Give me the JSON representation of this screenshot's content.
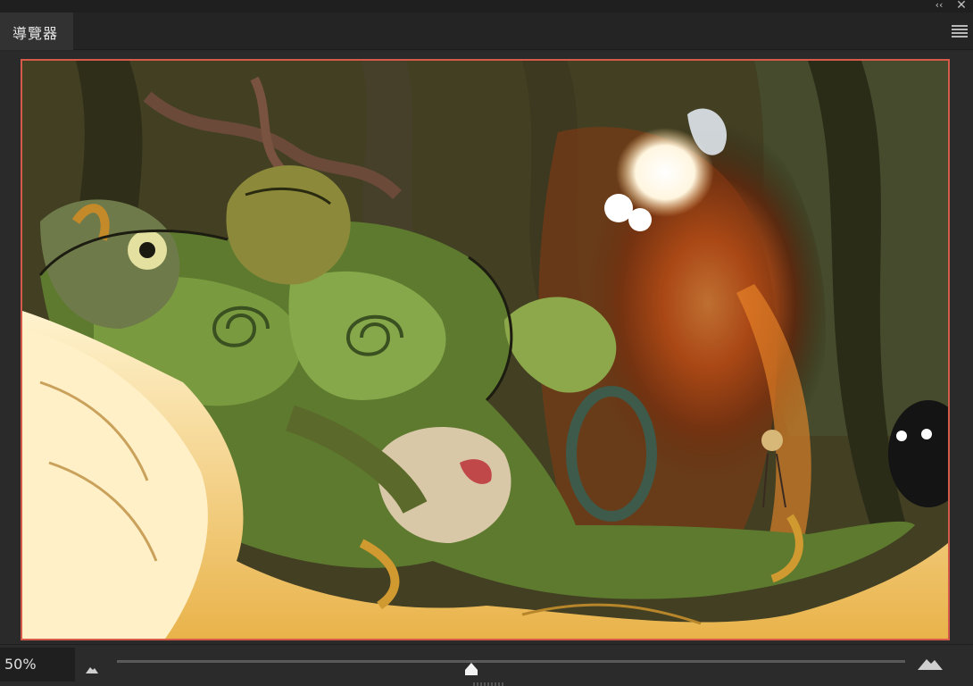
{
  "panel": {
    "tab_label": "導覽器",
    "collapse_glyph": "‹‹",
    "close_glyph": "✕"
  },
  "icons": {
    "collapse": "double-chevron-left-icon",
    "close": "close-icon",
    "menu": "hamburger-menu-icon",
    "zoom_out": "small-mountain-icon",
    "zoom_in": "large-mountain-icon"
  },
  "zoom": {
    "value": "50%",
    "slider_fraction": 0.45
  },
  "colors": {
    "frame_border": "#d65a4a",
    "panel_bg": "#282828"
  }
}
